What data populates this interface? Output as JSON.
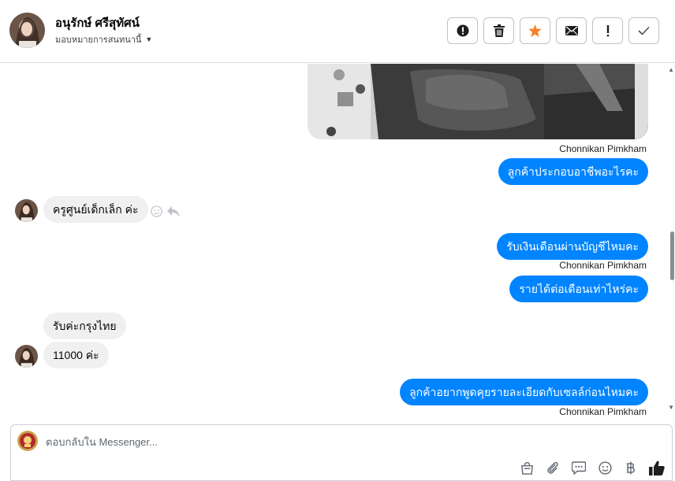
{
  "header": {
    "contact_name": "อนุรักษ์ ศรีสุทัศน์",
    "assign_label": "มอบหมายการสนทนานี้",
    "actions": [
      {
        "name": "spam-button",
        "icon": "alert-circle-icon"
      },
      {
        "name": "delete-button",
        "icon": "trash-icon"
      },
      {
        "name": "star-button",
        "icon": "star-icon"
      },
      {
        "name": "mark-unread-button",
        "icon": "envelope-icon"
      },
      {
        "name": "follow-up-button",
        "icon": "exclamation-icon"
      },
      {
        "name": "mark-done-button",
        "icon": "check-icon"
      }
    ]
  },
  "thread": {
    "messages": [
      {
        "sender": "Chonnikan Pimkham",
        "text": "ลูกค้าประกอบอาชีพอะไรคะ",
        "direction": "outgoing"
      },
      {
        "text": "ครูศูนย์เด็กเล็ก ค่ะ",
        "direction": "incoming"
      },
      {
        "text": "รับเงินเดือนผ่านบัญชีไหมคะ",
        "direction": "outgoing"
      },
      {
        "sender": "Chonnikan Pimkham",
        "text": "รายได้ต่อเดือนเท่าไหร่คะ",
        "direction": "outgoing"
      },
      {
        "text": "รับค่ะกรุงไทย",
        "direction": "incoming"
      },
      {
        "text": "11000 ค่ะ",
        "direction": "incoming"
      },
      {
        "text": "ลูกค้าอยากพูดคุยรายละเอียดกับเซลล์ก่อนไหมคะ",
        "direction": "outgoing"
      },
      {
        "sender": "Chonnikan Pimkham",
        "direction": "outgoing"
      }
    ]
  },
  "composer": {
    "placeholder": "ตอบกลับใน Messenger..."
  },
  "colors": {
    "outgoing_bubble": "#0084ff",
    "incoming_bubble": "#f0f0f0",
    "star_accent": "#f5822a"
  }
}
